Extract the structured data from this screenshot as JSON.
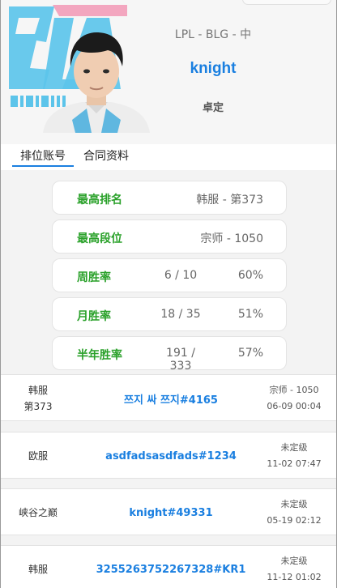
{
  "header": {
    "logo_text": "BLG BILIBILI GAMING",
    "league": "LPL - BLG - 中",
    "player_name": "knight",
    "status": "卓定"
  },
  "tabs": [
    {
      "label": "排位账号",
      "active": true
    },
    {
      "label": "合同资料",
      "active": false
    }
  ],
  "stats": {
    "highest_rank": {
      "label": "最高排名",
      "value": "韩服 - 第373"
    },
    "highest_tier": {
      "label": "最高段位",
      "value": "宗师 - 1050"
    },
    "week": {
      "label": "周胜率",
      "record": "6 / 10",
      "rate": "60%"
    },
    "month": {
      "label": "月胜率",
      "record": "18 / 35",
      "rate": "51%"
    },
    "half_year": {
      "label": "半年胜率",
      "record": "191 / 333",
      "rate": "57%"
    }
  },
  "accounts": [
    {
      "server": "韩服",
      "server_rank": "第373",
      "name": "쯔지 싸 쯔지#4165",
      "tier": "宗师 - 1050",
      "time": "06-09 00:04"
    },
    {
      "server": "欧服",
      "server_rank": "",
      "name": "asdfadsasdfads#1234",
      "tier": "未定级",
      "time": "11-02 07:47"
    },
    {
      "server": "峡谷之巅",
      "server_rank": "",
      "name": "knight#49331",
      "tier": "未定级",
      "time": "05-19 02:12"
    },
    {
      "server": "韩服",
      "server_rank": "",
      "name": "3255263752267328#KR1",
      "tier": "未定级",
      "time": "11-12 01:02"
    }
  ],
  "colors": {
    "accent_blue": "#1a7fe0",
    "label_green": "#2aa12a",
    "logo_blue": "#5cc4ea",
    "logo_pink": "#f3a6bf"
  }
}
